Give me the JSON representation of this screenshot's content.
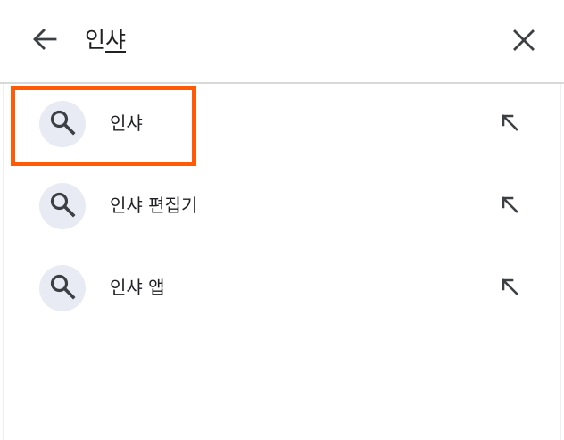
{
  "search": {
    "query_committed": "인",
    "query_composing": "샤"
  },
  "suggestions": [
    {
      "label": "인샤",
      "icon": "search-icon",
      "action_icon": "arrow-up-left-icon"
    },
    {
      "label": "인샤 편집기",
      "icon": "search-icon",
      "action_icon": "arrow-up-left-icon"
    },
    {
      "label": "인샤 앱",
      "icon": "search-icon",
      "action_icon": "arrow-up-left-icon"
    }
  ],
  "colors": {
    "highlight": "#ff5a06",
    "icon_bubble": "#e8ebf4",
    "icon": "#3c4043",
    "text": "#202124",
    "divider": "#d9d9d9"
  }
}
